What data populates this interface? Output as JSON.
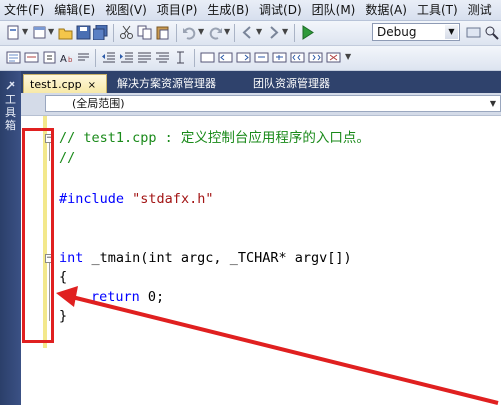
{
  "menubar": {
    "items": [
      "文件(F)",
      "编辑(E)",
      "视图(V)",
      "项目(P)",
      "生成(B)",
      "调试(D)",
      "团队(M)",
      "数据(A)",
      "工具(T)",
      "测试"
    ]
  },
  "toolbar": {
    "configuration": "Debug"
  },
  "left_strip": {
    "toolbox_label": "工具箱"
  },
  "tabs": [
    {
      "label": "test1.cpp",
      "active": true,
      "close": "×"
    },
    {
      "label": "解决方案资源管理器",
      "active": false
    },
    {
      "label": "团队资源管理器",
      "active": false
    }
  ],
  "scope": {
    "value": "(全局范围)"
  },
  "code": {
    "line1": "// test1.cpp : 定义控制台应用程序的入口点。",
    "line2": "//",
    "line3_kw": "#include",
    "line3_str": "\"stdafx.h\"",
    "line4_kw": "int",
    "line4_rest": " _tmain(int argc, _TCHAR* argv[])",
    "line5": "{",
    "line6_kw": "return",
    "line6_rest": " 0;",
    "line7": "}"
  },
  "colors": {
    "annotation": "#e02020",
    "comment": "#1a8a1a",
    "keyword": "#0000ff",
    "string": "#a31515"
  }
}
